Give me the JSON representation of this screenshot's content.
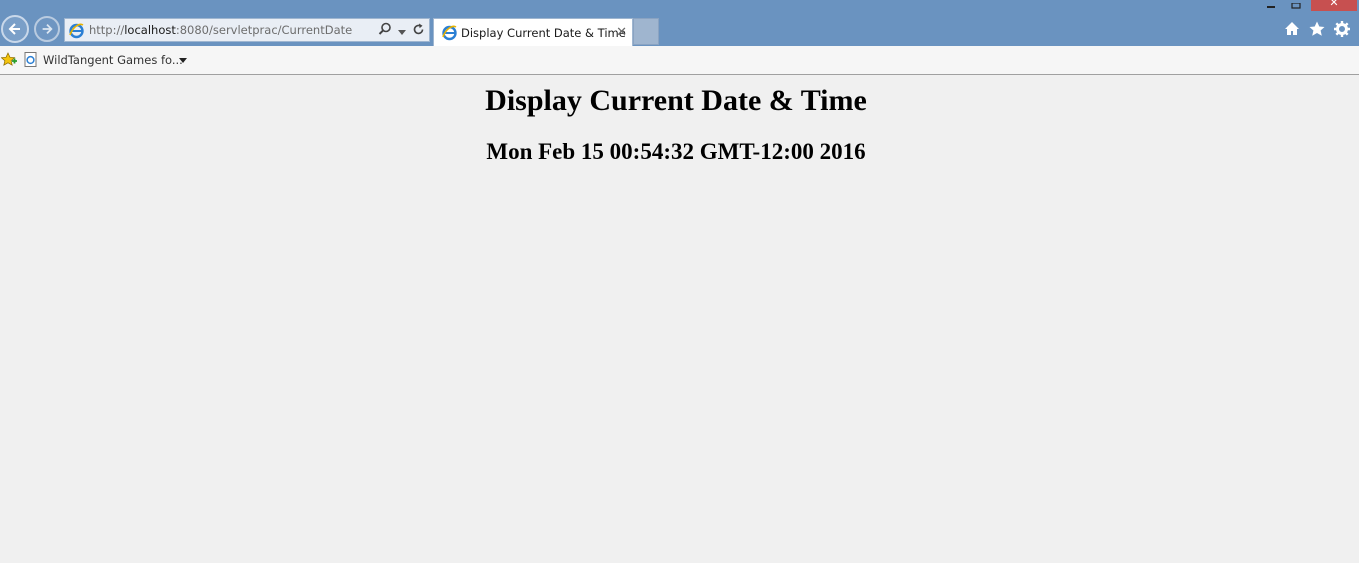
{
  "browser": {
    "address_scheme": "http://",
    "address_host": "localhost",
    "address_rest": ":8080/servletprac/CurrentDate",
    "tab_title": "Display Current Date & Time",
    "tab_close": "✕",
    "win_close": "✕"
  },
  "favorites": {
    "item_label": "WildTangent Games fo..."
  },
  "page": {
    "heading": "Display Current Date & Time",
    "date_text": "Mon Feb 15 00:54:32 GMT-12:00 2016"
  },
  "colors": {
    "titlebar": "#6a93c0",
    "page_bg": "#f0f0f0",
    "close_red": "#c75050"
  },
  "icons": {
    "back": "back-arrow-icon",
    "forward": "forward-arrow-icon",
    "ie": "internet-explorer-icon",
    "search": "search-icon",
    "refresh": "refresh-icon",
    "home": "home-icon",
    "favorites": "star-icon",
    "settings": "gear-icon"
  }
}
